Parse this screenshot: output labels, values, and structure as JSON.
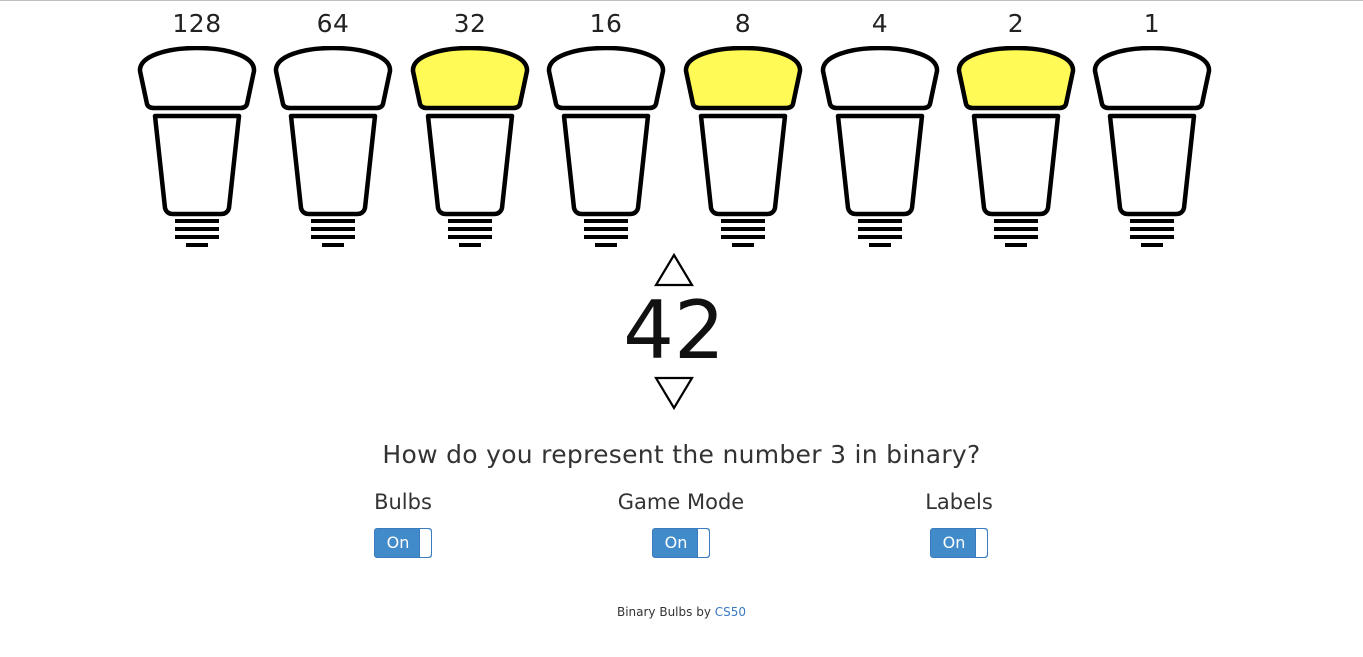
{
  "bulbs": [
    {
      "value": "128",
      "on": false
    },
    {
      "value": "64",
      "on": false
    },
    {
      "value": "32",
      "on": true
    },
    {
      "value": "16",
      "on": false
    },
    {
      "value": "8",
      "on": true
    },
    {
      "value": "4",
      "on": false
    },
    {
      "value": "2",
      "on": true
    },
    {
      "value": "1",
      "on": false
    }
  ],
  "colors": {
    "bulb_on": "#fffa55",
    "bulb_off": "#ffffff",
    "outline": "#000000",
    "toggle": "#428bca",
    "link": "#3a7bc0"
  },
  "number": "42",
  "question": "How do you represent the number 3 in binary?",
  "options": {
    "bulbs": {
      "label": "Bulbs",
      "state": "On"
    },
    "game_mode": {
      "label": "Game Mode",
      "state": "On"
    },
    "labels": {
      "label": "Labels",
      "state": "On"
    }
  },
  "footer": {
    "text": "Binary Bulbs by",
    "link": "CS50"
  },
  "icons": {
    "increment": "triangle-up-icon",
    "decrement": "triangle-down-icon"
  }
}
